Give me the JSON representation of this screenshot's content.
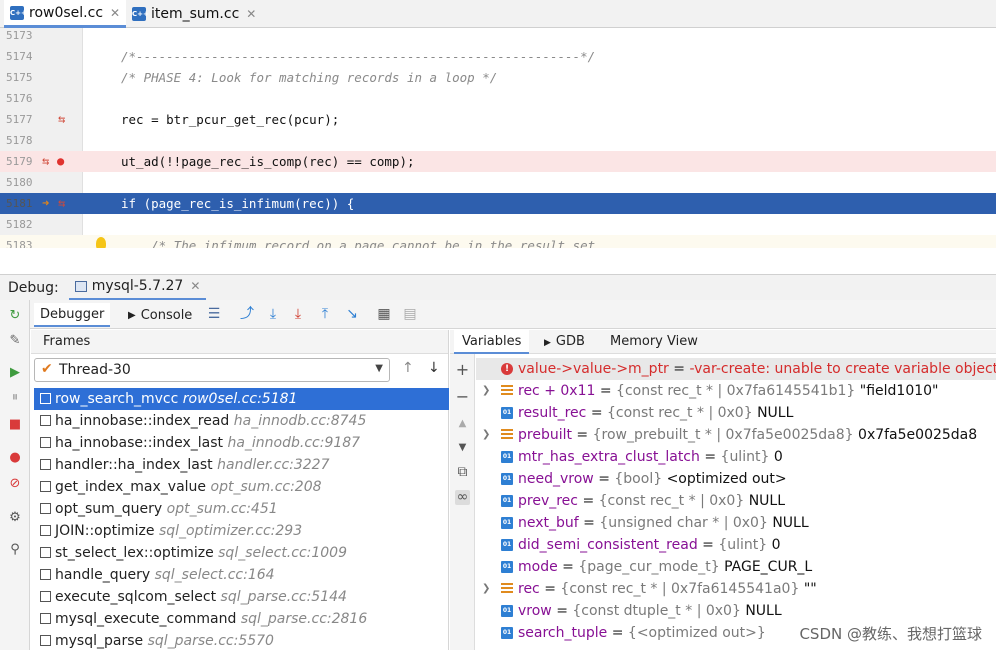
{
  "editor_tabs": [
    {
      "name": "row0sel.cc",
      "active": true
    },
    {
      "name": "item_sum.cc",
      "active": false
    }
  ],
  "file_icon_label": "C++",
  "code_lines": [
    {
      "num": "5173",
      "text": "",
      "kind": "code"
    },
    {
      "num": "5174",
      "text": "/*-----------------------------------------------------------*/",
      "kind": "comment"
    },
    {
      "num": "5175",
      "text": "/* PHASE 4: Look for matching records in a loop */",
      "kind": "comment"
    },
    {
      "num": "5176",
      "text": "",
      "kind": "code"
    },
    {
      "num": "5177",
      "text": "rec = btr_pcur_get_rec(pcur);",
      "kind": "code"
    },
    {
      "num": "5178",
      "text": "",
      "kind": "code"
    },
    {
      "num": "5179",
      "text": "ut_ad(!!page_rec_is_comp(rec) == comp);",
      "kind": "code"
    },
    {
      "num": "5180",
      "text": "",
      "kind": "code"
    },
    {
      "num": "5181",
      "text": "if (page_rec_is_infimum(rec)) {",
      "kind": "code"
    },
    {
      "num": "5182",
      "text": "",
      "kind": "code"
    },
    {
      "num": "5183",
      "text": "    /* The infimum record on a page cannot be in the result set.",
      "kind": "comment"
    }
  ],
  "debug": {
    "label": "Debug:",
    "config": "mysql-5.7.27",
    "tabs": [
      "Debugger",
      "Console"
    ]
  },
  "frames": {
    "header": "Frames",
    "thread": "Thread-30",
    "items": [
      {
        "func": "row_search_mvcc",
        "loc": "row0sel.cc:5181"
      },
      {
        "func": "ha_innobase::index_read",
        "loc": "ha_innodb.cc:8745"
      },
      {
        "func": "ha_innobase::index_last",
        "loc": "ha_innodb.cc:9187"
      },
      {
        "func": "handler::ha_index_last",
        "loc": "handler.cc:3227"
      },
      {
        "func": "get_index_max_value",
        "loc": "opt_sum.cc:208"
      },
      {
        "func": "opt_sum_query",
        "loc": "opt_sum.cc:451"
      },
      {
        "func": "JOIN::optimize",
        "loc": "sql_optimizer.cc:293"
      },
      {
        "func": "st_select_lex::optimize",
        "loc": "sql_select.cc:1009"
      },
      {
        "func": "handle_query",
        "loc": "sql_select.cc:164"
      },
      {
        "func": "execute_sqlcom_select",
        "loc": "sql_parse.cc:5144"
      },
      {
        "func": "mysql_execute_command",
        "loc": "sql_parse.cc:2816"
      },
      {
        "func": "mysql_parse",
        "loc": "sql_parse.cc:5570"
      }
    ]
  },
  "variables": {
    "tabs": [
      "Variables",
      "GDB",
      "Memory View"
    ],
    "items": [
      {
        "icon": "error",
        "expand": false,
        "name": "value->value->m_ptr",
        "type": "",
        "value": "-var-create: unable to create variable object",
        "error": true
      },
      {
        "icon": "struct",
        "expand": true,
        "name": "rec + 0x11",
        "type": "{const rec_t * | 0x7fa6145541b1}",
        "value": "\"field1010\""
      },
      {
        "icon": "pointer",
        "expand": false,
        "name": "result_rec",
        "type": "{const rec_t * | 0x0}",
        "value": "NULL"
      },
      {
        "icon": "struct",
        "expand": true,
        "name": "prebuilt",
        "type": "{row_prebuilt_t * | 0x7fa5e0025da8}",
        "value": "0x7fa5e0025da8"
      },
      {
        "icon": "pointer",
        "expand": false,
        "name": "mtr_has_extra_clust_latch",
        "type": "{ulint}",
        "value": "0"
      },
      {
        "icon": "pointer",
        "expand": false,
        "name": "need_vrow",
        "type": "{bool}",
        "value": "<optimized out>"
      },
      {
        "icon": "pointer",
        "expand": false,
        "name": "prev_rec",
        "type": "{const rec_t * | 0x0}",
        "value": "NULL"
      },
      {
        "icon": "pointer",
        "expand": false,
        "name": "next_buf",
        "type": "{unsigned char * | 0x0}",
        "value": "NULL"
      },
      {
        "icon": "pointer",
        "expand": false,
        "name": "did_semi_consistent_read",
        "type": "{ulint}",
        "value": "0"
      },
      {
        "icon": "pointer",
        "expand": false,
        "name": "mode",
        "type": "{page_cur_mode_t}",
        "value": "PAGE_CUR_L"
      },
      {
        "icon": "struct",
        "expand": true,
        "name": "rec",
        "type": "{const rec_t * | 0x7fa6145541a0}",
        "value": "\"\""
      },
      {
        "icon": "pointer",
        "expand": false,
        "name": "vrow",
        "type": "{const dtuple_t * | 0x0}",
        "value": "NULL"
      },
      {
        "icon": "pointer",
        "expand": false,
        "name": "search_tuple",
        "type": "{<optimized out>}",
        "value": ""
      }
    ]
  },
  "watermark": "CSDN @教练、我想打篮球",
  "colors": {
    "selection": "#2e6fd6",
    "current_line": "#2e5fae",
    "breakpoint_line": "#fbe5e5",
    "error_text": "#d52c2c",
    "var_name": "#871094"
  }
}
